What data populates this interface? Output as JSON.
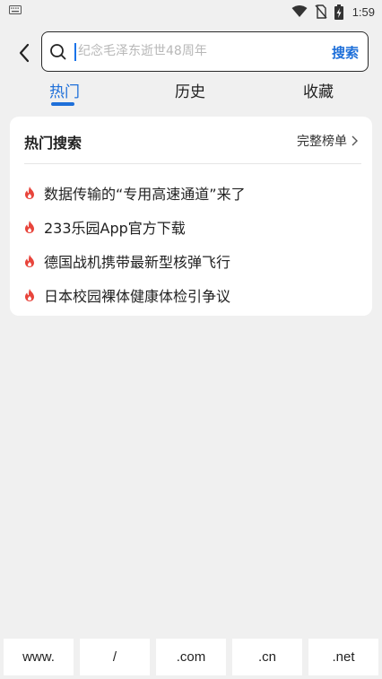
{
  "status_bar": {
    "time": "1:59",
    "icons": [
      "keyboard-icon",
      "wifi-icon",
      "no-sim-icon",
      "battery-charging-icon"
    ]
  },
  "header": {
    "back_icon": "chevron-left-icon",
    "search": {
      "placeholder": "纪念毛泽东逝世48周年",
      "value": "",
      "button_label": "搜索"
    }
  },
  "tabs": [
    {
      "label": "热门",
      "active": true
    },
    {
      "label": "历史",
      "active": false
    },
    {
      "label": "收藏",
      "active": false
    }
  ],
  "hot_card": {
    "title": "热门搜索",
    "full_list_label": "完整榜单",
    "items": [
      {
        "text": "数据传输的“专用高速通道”来了"
      },
      {
        "text": "233乐园App官方下载"
      },
      {
        "text": "德国战机携带最新型核弹飞行"
      },
      {
        "text": "日本校园裸体健康体检引争议"
      }
    ]
  },
  "shortcuts": [
    "www.",
    "/",
    ".com",
    ".cn",
    ".net"
  ],
  "colors": {
    "accent": "#1e6fd9",
    "fire": "#e8453c",
    "background": "#f0f0f0"
  }
}
